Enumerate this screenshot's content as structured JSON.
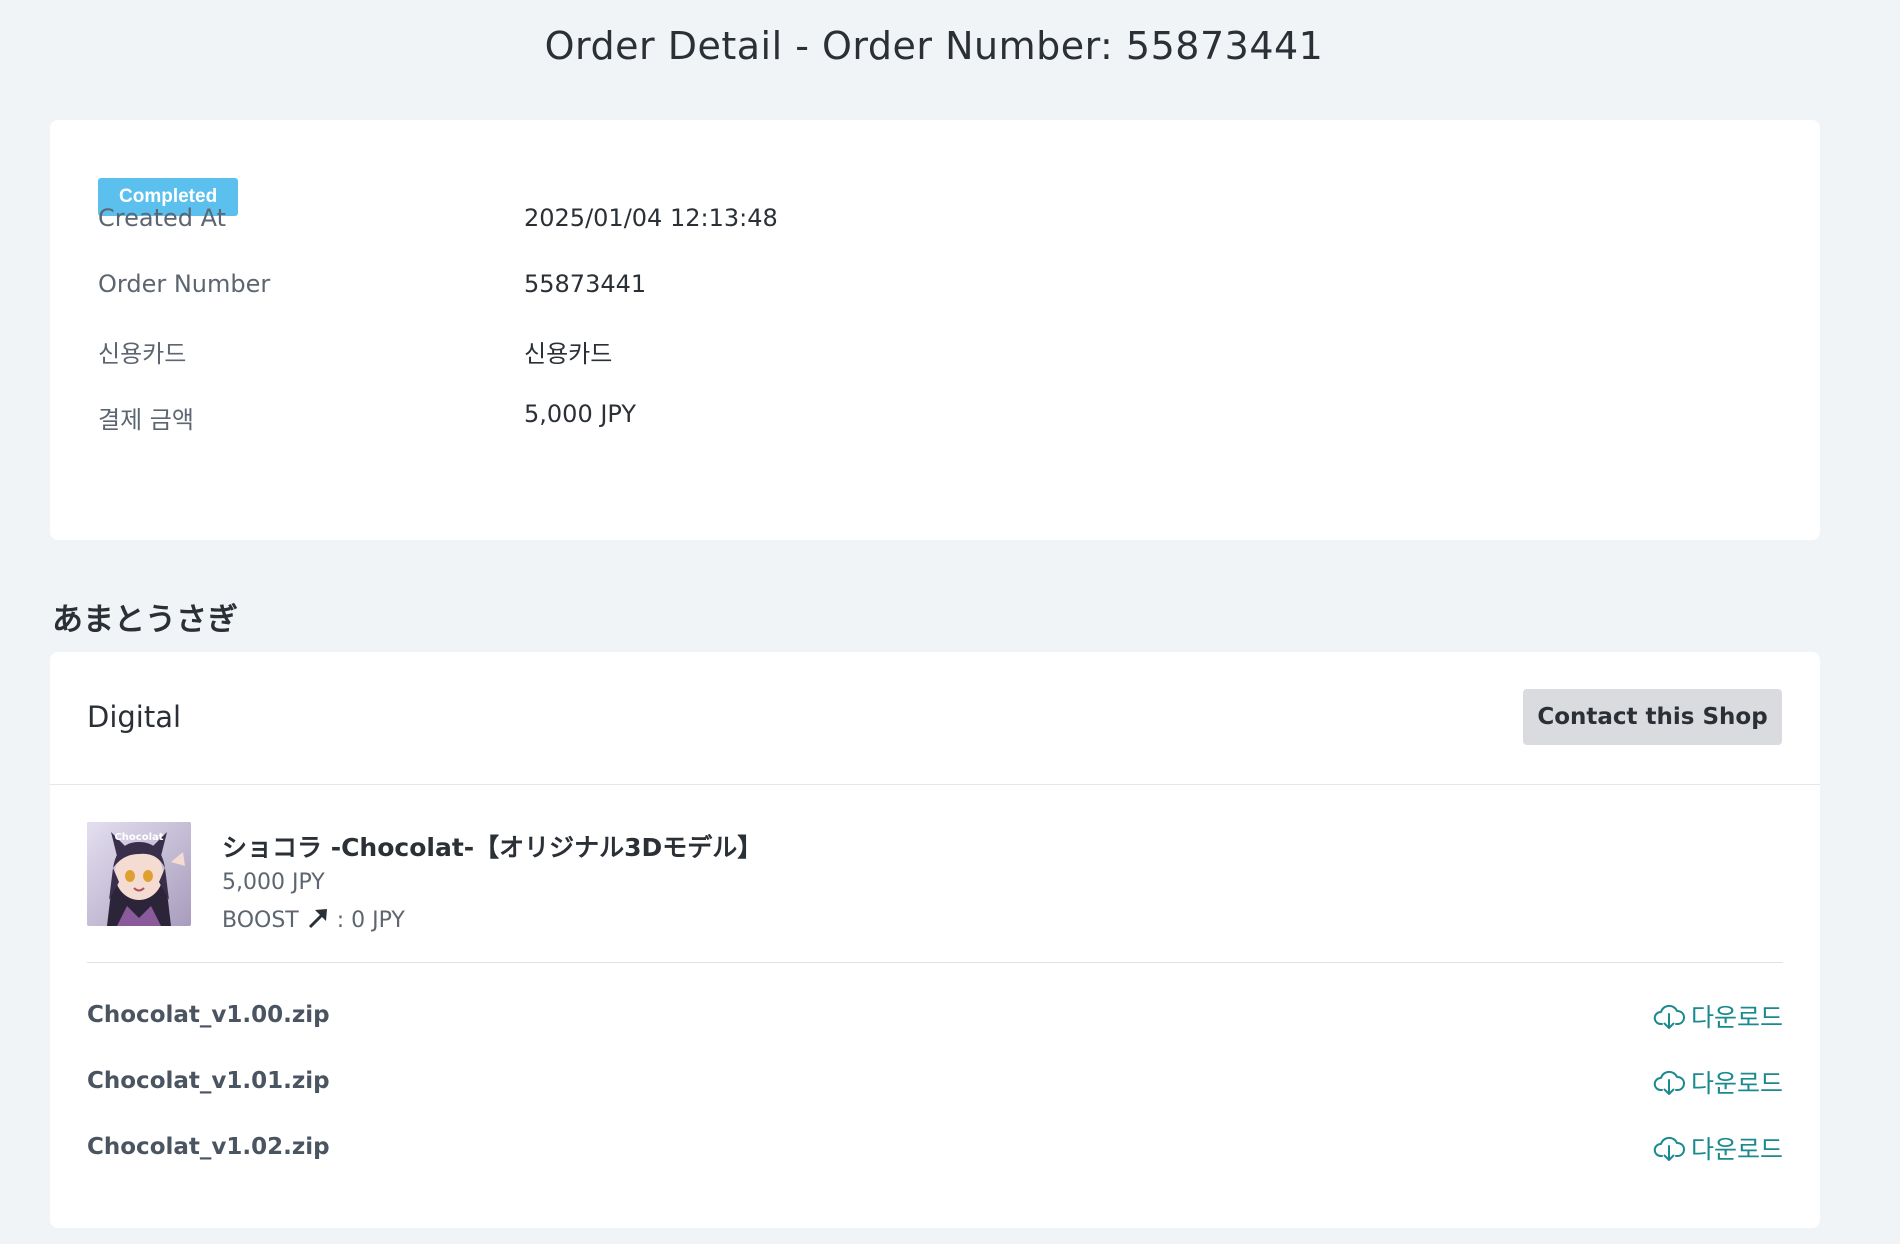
{
  "page_title": "Order Detail - Order Number: 55873441",
  "order": {
    "status_badge": "Completed",
    "fields": [
      {
        "label": "Created At",
        "value": "2025/01/04 12:13:48"
      },
      {
        "label": "Order Number",
        "value": "55873441"
      },
      {
        "label": "신용카드",
        "value": "신용카드"
      },
      {
        "label": "결제 금액",
        "value": "5,000 JPY"
      }
    ]
  },
  "shop": {
    "name": "あまとうさぎ",
    "category": "Digital",
    "contact_label": "Contact this Shop",
    "product": {
      "name": "ショコラ -Chocolat-【オリジナル3Dモデル】",
      "price": "5,000 JPY",
      "boost_label": "BOOST",
      "boost_value": "0 JPY",
      "thumb_text": "Chocolat"
    },
    "files": [
      {
        "name": "Chocolat_v1.00.zip",
        "download_label": "다운로드"
      },
      {
        "name": "Chocolat_v1.01.zip",
        "download_label": "다운로드"
      },
      {
        "name": "Chocolat_v1.02.zip",
        "download_label": "다운로드"
      }
    ]
  },
  "colors": {
    "background": "#f1f4f7",
    "badge": "#5bc0ee",
    "download_link": "#1b8a8e",
    "contact_button": "#dadbde"
  }
}
